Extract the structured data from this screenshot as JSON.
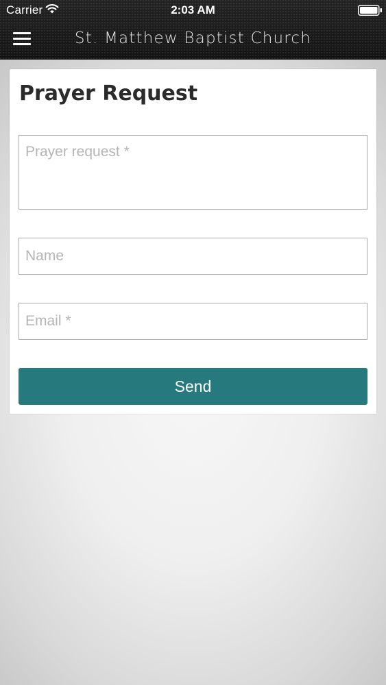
{
  "status_bar": {
    "carrier": "Carrier",
    "time": "2:03 AM"
  },
  "nav_bar": {
    "title": "St. Matthew Baptist Church",
    "menu_icon": "hamburger-menu-icon"
  },
  "form": {
    "title": "Prayer Request",
    "prayer_request": {
      "placeholder": "Prayer request *",
      "value": ""
    },
    "name": {
      "placeholder": "Name",
      "value": ""
    },
    "email": {
      "placeholder": "Email *",
      "value": ""
    },
    "send_label": "Send"
  },
  "colors": {
    "header_background": "#1c1c1c",
    "send_button": "#267a7e",
    "page_background": "#efefef"
  }
}
